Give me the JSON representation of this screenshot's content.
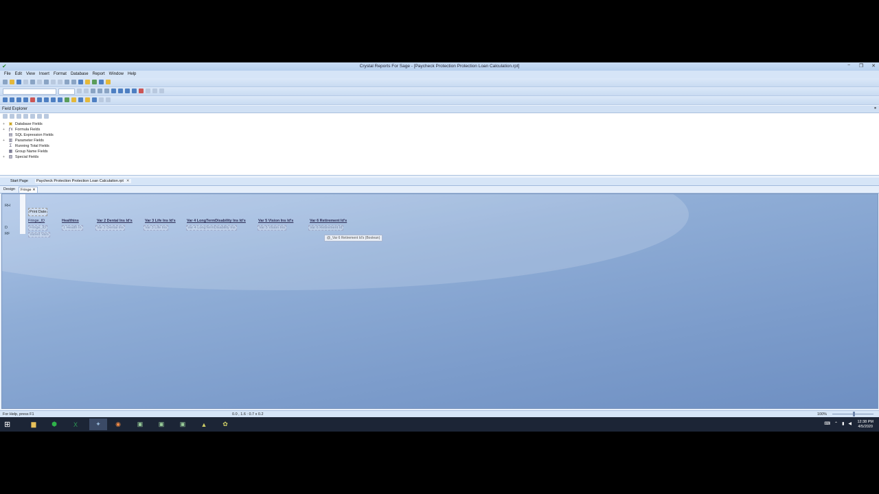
{
  "window": {
    "title": "Crystal Reports For Sage - [Paycheck Protection Protection Loan Calculation.rpt]",
    "controls": {
      "minimize": "−",
      "restore": "❐",
      "close": "✕"
    }
  },
  "menu": [
    "File",
    "Edit",
    "View",
    "Insert",
    "Format",
    "Database",
    "Report",
    "Window",
    "Help"
  ],
  "field_explorer": {
    "title": "Field Explorer",
    "pin": "⏸",
    "items": [
      {
        "label": "Database Fields",
        "expander": "+",
        "icon": "▣"
      },
      {
        "label": "Formula Fields",
        "expander": "+",
        "icon": "ƒx"
      },
      {
        "label": "SQL Expression Fields",
        "expander": "",
        "icon": "▤"
      },
      {
        "label": "Parameter Fields",
        "expander": "+",
        "icon": "▥"
      },
      {
        "label": "Running Total Fields",
        "expander": "",
        "icon": "Σ"
      },
      {
        "label": "Group Name Fields",
        "expander": "",
        "icon": "▦"
      },
      {
        "label": "Special Fields",
        "expander": "+",
        "icon": "▧"
      }
    ]
  },
  "doc_tabs": [
    {
      "label": "Start Page"
    },
    {
      "label": "Paycheck Protection Protection Loan Calculation.rpt",
      "close": "✕"
    }
  ],
  "sub_tabs": [
    {
      "label": "Design"
    },
    {
      "label": "Fringe",
      "close": "✕"
    }
  ],
  "sections": [
    "RH",
    "D",
    "RF"
  ],
  "report": {
    "print_date": "Print Date",
    "fringe_id_header": "Fringe_ID",
    "headers": [
      "Healthins",
      "Var 2 Dental Ins Id's",
      "Var 3 Life Ins Id's",
      "Var 4 LongTermDisability Ins Id's",
      "Var 5 Vision Ins Id's",
      "Var 6 Retirement Id's"
    ],
    "detail_fields": [
      "Fringe_ID",
      "1 Health In",
      "Var 2 Dental Ins",
      "Var 3 Life Ins",
      "Var 4 LongTermDisability Ins",
      "Var 5 Vision Ins",
      "Var 6 Retirement Id"
    ],
    "footer_field": "Varied Vars",
    "tooltip": "@_Var 6 Retirement Id's (Boolean)"
  },
  "status": {
    "help": "For Help, press F1",
    "coords": "0.0 , 1.6 : 0.7 x 0.2",
    "zoom": "100%"
  },
  "taskbar": {
    "time": "12:38 PM",
    "date": "4/5/2020",
    "apps": [
      "file-explorer-icon",
      "app-green-icon",
      "excel-icon",
      "crystal-icon",
      "chrome-icon",
      "app-icon-1",
      "app-icon-2",
      "app-icon-3",
      "app-icon-4",
      "app-icon-5"
    ]
  },
  "colors": {
    "design_bg": "#8fadd6",
    "taskbar": "#1c2536",
    "chrome_bg": "#d6e5f7"
  }
}
